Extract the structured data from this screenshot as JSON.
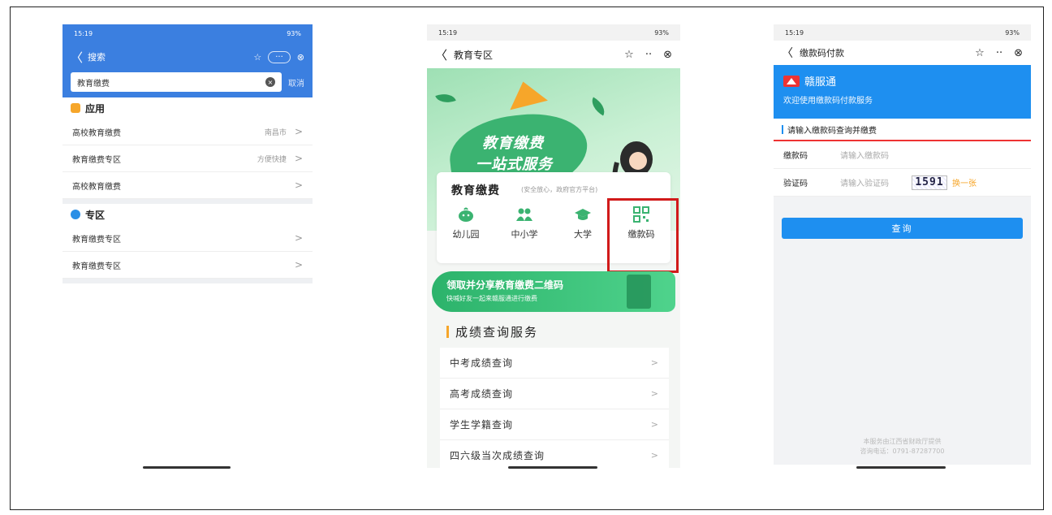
{
  "phone1": {
    "status": {
      "time": "15:19",
      "right": "93%"
    },
    "nav": {
      "back": "〈",
      "title": "搜索",
      "close": "⊗"
    },
    "search": {
      "value": "教育缴费",
      "cancel": "取消"
    },
    "apps_title": "应用",
    "apps": [
      {
        "label": "高校教育缴费",
        "meta": "南昌市"
      },
      {
        "label": "教育缴费专区",
        "meta": "方便快捷"
      },
      {
        "label": "高校教育缴费",
        "meta": ""
      }
    ],
    "zone_title": "专区",
    "zone": [
      {
        "label": "教育缴费专区"
      },
      {
        "label": "教育缴费专区"
      }
    ]
  },
  "phone2": {
    "status": {
      "time": "15:19",
      "right": "93%"
    },
    "nav": {
      "back": "〈",
      "title": "教育专区",
      "star": "☆",
      "more": "··",
      "close": "⊗"
    },
    "banner": {
      "line1": "教育缴费",
      "line2": "一站式服务"
    },
    "card": {
      "title": "教育缴费",
      "subtitle": "(安全放心，政府官方平台)",
      "items": [
        {
          "label": "幼儿园",
          "color": "#3bb371"
        },
        {
          "label": "中小学",
          "color": "#3bb371"
        },
        {
          "label": "大学",
          "color": "#3bb371"
        },
        {
          "label": "缴款码",
          "color": "#3bb371"
        }
      ]
    },
    "promo": {
      "title": "领取并分享教育缴费二维码",
      "sub": "快喊好友一起来赣服通进行缴费"
    },
    "section": "成绩查询服务",
    "list": [
      "中考成绩查询",
      "高考成绩查询",
      "学生学籍查询",
      "四六级当次成绩查询"
    ]
  },
  "phone3": {
    "status": {
      "time": "15:19",
      "right": "93%"
    },
    "nav": {
      "back": "〈",
      "title": "缴款码付款",
      "star": "☆",
      "more": "··",
      "close": "⊗"
    },
    "hero": {
      "brand": "赣服通",
      "sub": "欢迎使用缴款码付款服务"
    },
    "form_title": "请输入缴款码查询并缴费",
    "fields": {
      "code_label": "缴款码",
      "code_ph": "请输入缴款码",
      "verify_label": "验证码",
      "verify_ph": "请输入验证码",
      "captcha": "1591",
      "refresh": "换一张"
    },
    "button": "查询",
    "footer": {
      "line1": "本服务由江西省财政厅提供",
      "line2": "咨询电话：0791-87287700"
    }
  }
}
